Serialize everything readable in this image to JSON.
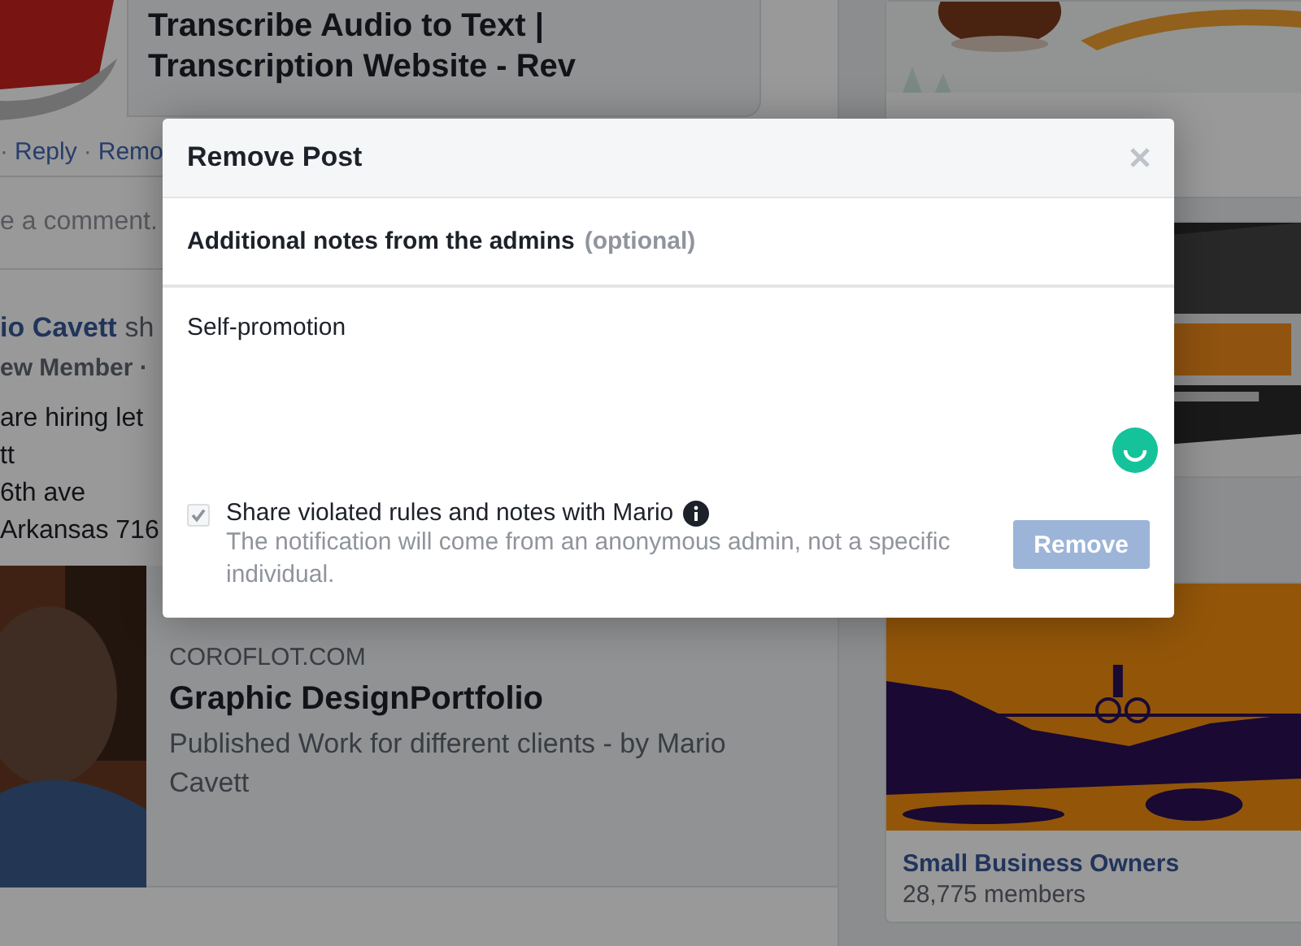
{
  "background": {
    "left_column": {
      "link_preview": {
        "title": "Transcribe Audio to Text | Transcription Website - Rev"
      },
      "comment_actions": {
        "separator": "·",
        "items": [
          {
            "label": "Reply"
          },
          {
            "label": "Remo"
          }
        ]
      },
      "comment_input": {
        "placeholder": "e a comment."
      },
      "post": {
        "author": "io Cavett",
        "action": "sh",
        "meta": "ew Member ·",
        "lines": [
          "are hiring let",
          "tt",
          "6th ave",
          "Arkansas 716"
        ],
        "shared_link": {
          "domain": "COROFLOT.COM",
          "title": "Graphic DesignPortfolio",
          "description": "Published Work for different clients - by Mario Cavett"
        }
      }
    },
    "right_column": {
      "groups": [
        {
          "kind": "logo"
        },
        {
          "kind": "banner"
        },
        {
          "name": "Small Business Owners",
          "members": "28,775 members"
        }
      ]
    }
  },
  "dialog": {
    "title": "Remove Post",
    "notes_label": {
      "text": "Additional notes from the admins",
      "hint": "(optional)"
    },
    "notes": {
      "value": "Self-promotion"
    },
    "share_option": {
      "label": "Share violated rules and notes with Mario",
      "checked": true,
      "disabled": true,
      "description": "The notification will come from an anonymous admin, not a specific individual."
    },
    "remove_button": {
      "label": "Remove",
      "disabled": true
    }
  }
}
